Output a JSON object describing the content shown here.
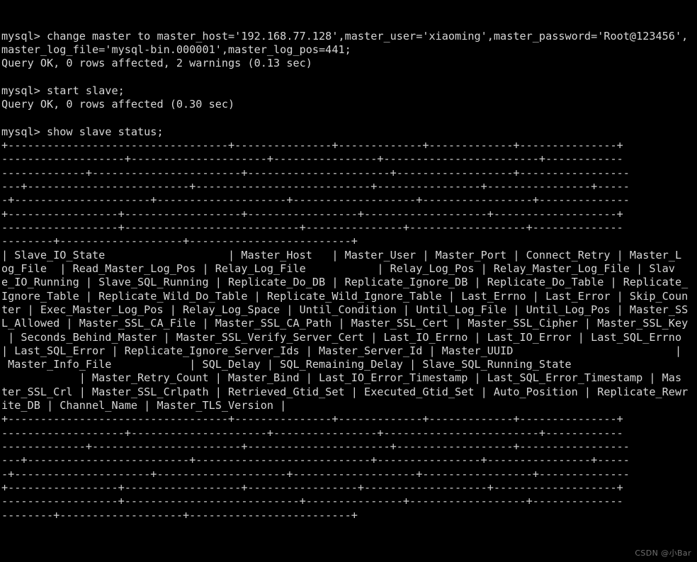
{
  "terminal": {
    "title": "mysql",
    "colors": {
      "background": "#000000",
      "foreground": "#d6d6d6",
      "separator": "#cfcfcf",
      "watermark": "#6e6e6e"
    },
    "prompt": "mysql>",
    "watermark": "CSDN @小Bar",
    "commands": [
      {
        "prompt": "mysql>",
        "input": "change master to master_host='192.168.77.128',master_user='xiaoming',master_password='Root@123456',master_log_file='mysql-bin.000001',master_log_pos=441;",
        "result": "Query OK, 0 rows affected, 2 warnings (0.13 sec)"
      },
      {
        "prompt": "mysql>",
        "input": "start slave;",
        "result": "Query OK, 0 rows affected (0.30 sec)"
      },
      {
        "prompt": "mysql>",
        "input": "show slave status;",
        "result": ""
      }
    ],
    "lines": [
      "mysql> change master to master_host='192.168.77.128',master_user='xiaoming',master_password='Root@123456',",
      "master_log_file='mysql-bin.000001',master_log_pos=441;",
      "Query OK, 0 rows affected, 2 warnings (0.13 sec)",
      "",
      "mysql> start slave;",
      "Query OK, 0 rows affected (0.30 sec)",
      "",
      "mysql> show slave status;",
      "+----------------------------------+---------------+-------------+-------------+---------------+",
      "-------------------+---------------------+----------------+------------------------+------------",
      "-------------+-----------------------+----------------------+------------------+-----------------",
      "---+-------------------------+---------------------------+----------------+----------------+-----",
      "-+---------------------+--------------------+-------------------+-----------------+--------------",
      "+-----------------+------------------+-----------------+-------------------+-------------------+",
      "------------------+---------------------------+---------------+------------------+--------------",
      "--------+-------------------+-------------------------+",
      "| Slave_IO_State                   | Master_Host   | Master_User | Master_Port | Connect_Retry | Master_L",
      "og_File  | Read_Master_Log_Pos | Relay_Log_File           | Relay_Log_Pos | Relay_Master_Log_File | Slav",
      "e_IO_Running | Slave_SQL_Running | Replicate_Do_DB | Replicate_Ignore_DB | Replicate_Do_Table | Replicate_",
      "Ignore_Table | Replicate_Wild_Do_Table | Replicate_Wild_Ignore_Table | Last_Errno | Last_Error | Skip_Coun",
      "ter | Exec_Master_Log_Pos | Relay_Log_Space | Until_Condition | Until_Log_File | Until_Log_Pos | Master_SS",
      "L_Allowed | Master_SSL_CA_File | Master_SSL_CA_Path | Master_SSL_Cert | Master_SSL_Cipher | Master_SSL_Key",
      " | Seconds_Behind_Master | Master_SSL_Verify_Server_Cert | Last_IO_Errno | Last_IO_Error | Last_SQL_Errno",
      "| Last_SQL_Error | Replicate_Ignore_Server_Ids | Master_Server_Id | Master_UUID                         |",
      " Master_Info_File            | SQL_Delay | SQL_Remaining_Delay | Slave_SQL_Running_State",
      "            | Master_Retry_Count | Master_Bind | Last_IO_Error_Timestamp | Last_SQL_Error_Timestamp | Mas",
      "ter_SSL_Crl | Master_SSL_Crlpath | Retrieved_Gtid_Set | Executed_Gtid_Set | Auto_Position | Replicate_Rewr",
      "ite_DB | Channel_Name | Master_TLS_Version |",
      "+----------------------------------+---------------+-------------+-------------+---------------+",
      "-------------------+---------------------+----------------+------------------------+------------",
      "-------------+-----------------------+----------------------+------------------+-----------------",
      "---+-------------------------+---------------------------+----------------+----------------+-----",
      "-+---------------------+--------------------+-------------------+-----------------+--------------",
      "+-----------------+------------------+-----------------+-------------------+-------------------+",
      "------------------+---------------------------+---------------+------------------+--------------",
      "--------+-------------------+-------------------------+"
    ],
    "columns": [
      "Slave_IO_State",
      "Master_Host",
      "Master_User",
      "Master_Port",
      "Connect_Retry",
      "Master_Log_File",
      "Read_Master_Log_Pos",
      "Relay_Log_File",
      "Relay_Log_Pos",
      "Relay_Master_Log_File",
      "Slave_IO_Running",
      "Slave_SQL_Running",
      "Replicate_Do_DB",
      "Replicate_Ignore_DB",
      "Replicate_Do_Table",
      "Replicate_Ignore_Table",
      "Replicate_Wild_Do_Table",
      "Replicate_Wild_Ignore_Table",
      "Last_Errno",
      "Last_Error",
      "Skip_Counter",
      "Exec_Master_Log_Pos",
      "Relay_Log_Space",
      "Until_Condition",
      "Until_Log_File",
      "Until_Log_Pos",
      "Master_SSL_Allowed",
      "Master_SSL_CA_File",
      "Master_SSL_CA_Path",
      "Master_SSL_Cert",
      "Master_SSL_Cipher",
      "Master_SSL_Key",
      "Seconds_Behind_Master",
      "Master_SSL_Verify_Server_Cert",
      "Last_IO_Errno",
      "Last_IO_Error",
      "Last_SQL_Errno",
      "Last_SQL_Error",
      "Replicate_Ignore_Server_Ids",
      "Master_Server_Id",
      "Master_UUID",
      "Master_Info_File",
      "SQL_Delay",
      "SQL_Remaining_Delay",
      "Slave_SQL_Running_State",
      "Master_Retry_Count",
      "Master_Bind",
      "Last_IO_Error_Timestamp",
      "Last_SQL_Error_Timestamp",
      "Master_SSL_Crl",
      "Master_SSL_Crlpath",
      "Retrieved_Gtid_Set",
      "Executed_Gtid_Set",
      "Auto_Position",
      "Replicate_Rewrite_DB",
      "Channel_Name",
      "Master_TLS_Version"
    ]
  }
}
